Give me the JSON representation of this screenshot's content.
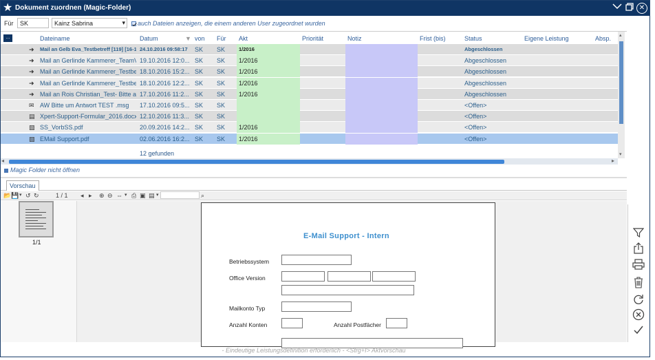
{
  "window": {
    "title": "Dokument zuordnen (Magic-Folder)"
  },
  "filter": {
    "fuer_label": "Für",
    "fuer_code": "SK",
    "user_name": "Kainz Sabrina",
    "show_other_label": "auch Dateien anzeigen, die einem anderen User zugeordnet wurden",
    "show_other_checked": true
  },
  "grid": {
    "corner": "...",
    "columns": [
      "Dateiname",
      "Datum",
      "von",
      "Für",
      "Akt",
      "Priorität",
      "Notiz",
      "Frist (bis)",
      "Status",
      "Eigene Leistung",
      "Absp."
    ],
    "rows": [
      {
        "icon": "arrow-icon",
        "name": "Mail an Gelb Eva_Testbetreff [119] [16-10-...",
        "date": "24.10.2016 09:58:17",
        "von": "SK",
        "fuer": "SK",
        "akt": "1/2016",
        "status": "Abgeschlossen",
        "eigene": true,
        "bold": true,
        "style": "dark"
      },
      {
        "icon": "arrow-icon",
        "name": "Mail an Gerlinde Kammerer_TeamV...",
        "date": "19.10.2016 12:0...",
        "von": "SK",
        "fuer": "SK",
        "akt": "1/2016",
        "status": "Abgeschlossen",
        "eigene": true,
        "style": "light"
      },
      {
        "icon": "arrow-icon",
        "name": "Mail an Gerlinde Kammerer_Testbe...",
        "date": "18.10.2016 15:2...",
        "von": "SK",
        "fuer": "SK",
        "akt": "1/2016",
        "status": "Abgeschlossen",
        "eigene": true,
        "style": "dark"
      },
      {
        "icon": "arrow-icon",
        "name": "Mail an Gerlinde Kammerer_Testbe...",
        "date": "18.10.2016 12:2...",
        "von": "SK",
        "fuer": "SK",
        "akt": "1/2016",
        "status": "Abgeschlossen",
        "eigene": true,
        "style": "light"
      },
      {
        "icon": "arrow-icon",
        "name": "Mail an Rois Christian_Test- Bitte an...",
        "date": "17.10.2016 11:2...",
        "von": "SK",
        "fuer": "SK",
        "akt": "1/2016",
        "status": "Abgeschlossen",
        "eigene": true,
        "style": "dark"
      },
      {
        "icon": "envelope-icon",
        "name": "AW  Bitte um Antwort TEST .msg",
        "date": "17.10.2016 09:5...",
        "von": "SK",
        "fuer": "SK",
        "akt": "",
        "status": "<Offen>",
        "eigene": true,
        "style": "light"
      },
      {
        "icon": "word-doc-icon",
        "name": "Xpert-Support-Formular_2016.docx",
        "date": "12.10.2016 11:3...",
        "von": "SK",
        "fuer": "SK",
        "akt": "",
        "status": "<Offen>",
        "eigene": true,
        "style": "dark"
      },
      {
        "icon": "pdf-icon",
        "name": "SS_VorbSS.pdf",
        "date": "20.09.2016 14:2...",
        "von": "SK",
        "fuer": "SK",
        "akt": "1/2016",
        "status": "<Offen>",
        "eigene": true,
        "style": "light"
      },
      {
        "icon": "pdf-icon",
        "name": "EMail Support.pdf",
        "date": "02.06.2016 16:2...",
        "von": "SK",
        "fuer": "SK",
        "akt": "1/2016",
        "status": "<Offen>",
        "eigene": true,
        "style": "selected"
      }
    ],
    "found": "12 gefunden"
  },
  "magic": {
    "label": "Magic Folder nicht öffnen"
  },
  "preview": {
    "tab": "Vorschau",
    "page_counter": "1 / 1",
    "thumb_label": "1/1",
    "doc": {
      "title": "E-Mail Support - Intern",
      "os": "Betriebssystem",
      "office": "Office Version",
      "mailtype": "Mailkonto Typ",
      "konten": "Anzahl Konten",
      "postfaecher": "Anzahl Postfächer"
    }
  },
  "status": {
    "text": "-  Eindeutige Leistungsdefinition erforderlich -  <Strg+I> Aktvorschau"
  },
  "colors": {
    "titlebar": "#0f3564",
    "akt": "#c8f0c8",
    "notiz": "#c8c8f8",
    "selected": "#a8c8ee"
  }
}
